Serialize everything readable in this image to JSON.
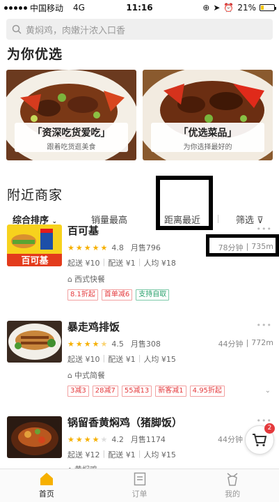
{
  "status_bar": {
    "carrier": "中国移动",
    "network": "4G",
    "time": "11:16",
    "battery": "21%",
    "battery_level": 0.21
  },
  "search": {
    "placeholder": "黄焖鸡，肉嫩汁浓入口香"
  },
  "featured": {
    "title": "为你优选",
    "banners": [
      {
        "title": "「资深吃货爱吃」",
        "subtitle": "跟着吃货逛美食"
      },
      {
        "title": "「优选菜品」",
        "subtitle": "为你选择最好的"
      }
    ]
  },
  "nearby": {
    "title": "附近商家",
    "tabs": [
      "综合排序",
      "销量最高",
      "距离最近",
      "筛选"
    ]
  },
  "shops": [
    {
      "name": "百可基",
      "rating": "4.8",
      "rating_value": 4.8,
      "sold": "月售796",
      "fees": [
        "起送 ¥10",
        "配送 ¥1",
        "人均 ¥18"
      ],
      "category": "西式快餐",
      "promos": [
        "8.1折起",
        "首单减6",
        "支持自取"
      ],
      "time": "78分钟",
      "distance": "735m",
      "thumb_text": "百可基"
    },
    {
      "name": "暴走鸡排饭",
      "rating": "4.5",
      "rating_value": 4.5,
      "sold": "月售308",
      "fees": [
        "起送 ¥10",
        "配送 ¥1",
        "人均 ¥15"
      ],
      "category": "中式简餐",
      "promos": [
        "3减3",
        "28减7",
        "55减13",
        "新客减1",
        "4.95折起"
      ],
      "time": "44分钟",
      "distance": "772m"
    },
    {
      "name": "锅留香黄焖鸡（猪脚饭）",
      "rating": "4.2",
      "rating_value": 4.2,
      "sold": "月售1174",
      "fees": [
        "起送 ¥12",
        "配送 ¥1",
        "人均 ¥15"
      ],
      "category": "黄焖鸡",
      "time": "44分钟"
    }
  ],
  "cart": {
    "count": "2"
  },
  "tabbar": [
    "首页",
    "订单",
    "我的"
  ],
  "colors": {
    "accent": "#f6b000",
    "promo": "#e4393c",
    "promo_green": "#27a06b"
  }
}
